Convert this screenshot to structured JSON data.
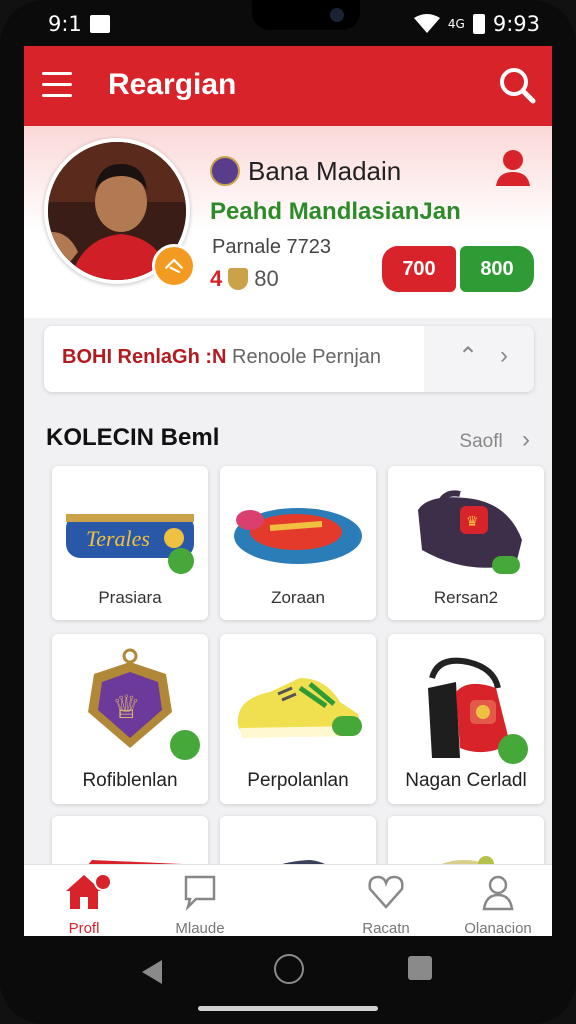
{
  "status_bar": {
    "time_left": "9:1",
    "time_right": "9:93",
    "signal_label": "4G"
  },
  "app_bar": {
    "title": "Reargian",
    "menu_icon": "hamburger-icon",
    "search_icon": "search-icon"
  },
  "profile": {
    "name": "Bana Madain",
    "subtitle": "Peahd MandlasianJan",
    "meta": "Parnale 7723",
    "stat_red": "4",
    "stat_gray": "80",
    "button_red": "700",
    "button_green": "800"
  },
  "banner": {
    "bold_text": "BOHI RenlaGh :N",
    "text": "Renoole Pernjan"
  },
  "section": {
    "title": "KOLECIN Beml",
    "more_label": "Saofl"
  },
  "items": [
    {
      "label": "Prasiara"
    },
    {
      "label": "Zoraan"
    },
    {
      "label": "Rersan2"
    },
    {
      "label": "Rofiblenlan"
    },
    {
      "label": "Perpolanlan"
    },
    {
      "label": "Nagan Cerladl"
    }
  ],
  "bottom_nav": [
    {
      "label": "Profl",
      "icon": "home-icon",
      "active": true
    },
    {
      "label": "Mlaude",
      "icon": "chat-icon",
      "active": false
    },
    {
      "label": "Racatn",
      "icon": "heart-icon",
      "active": false
    },
    {
      "label": "Olanacion",
      "icon": "user-icon",
      "active": false
    }
  ],
  "colors": {
    "primary_red": "#d8232a",
    "accent_green": "#2f9b34",
    "badge_orange": "#f39a20"
  }
}
